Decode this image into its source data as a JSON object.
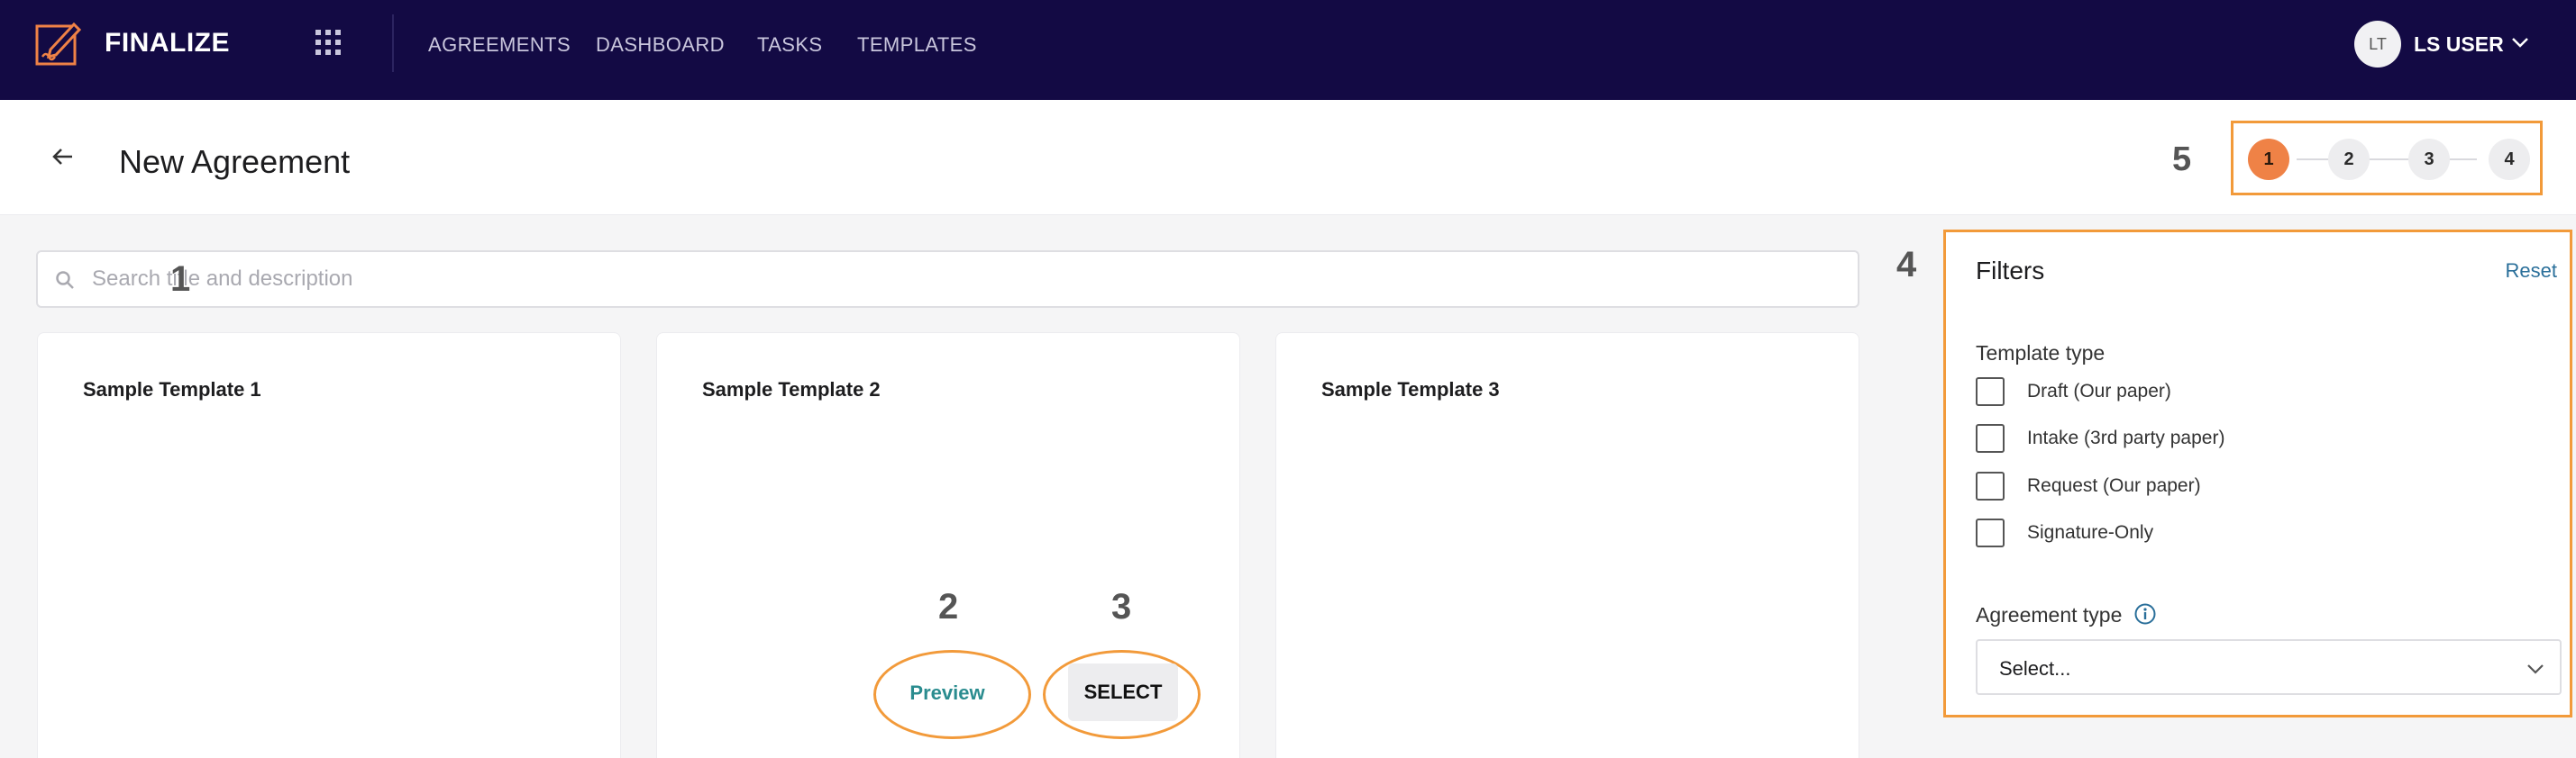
{
  "app": {
    "brand": "FINALIZE"
  },
  "nav": {
    "items": [
      "AGREEMENTS",
      "DASHBOARD",
      "TASKS",
      "TEMPLATES"
    ]
  },
  "user": {
    "initials": "LT",
    "name": "LS USER"
  },
  "page": {
    "title": "New Agreement"
  },
  "stepper": {
    "steps": [
      "1",
      "2",
      "3",
      "4"
    ],
    "current_step": 1
  },
  "search": {
    "placeholder": "Search title and description",
    "value": ""
  },
  "templates": [
    "Sample Template 1",
    "Sample Template 2",
    "Sample Template 3"
  ],
  "card_actions": {
    "preview_label": "Preview",
    "select_label": "SELECT"
  },
  "annotations": {
    "search": "1",
    "preview": "2",
    "select": "3",
    "filters": "4",
    "stepper": "5"
  },
  "filters": {
    "title": "Filters",
    "reset_label": "Reset",
    "template_type_label": "Template type",
    "template_types": [
      "Draft (Our paper)",
      "Intake (3rd party paper)",
      "Request (Our paper)",
      "Signature-Only"
    ],
    "agreement_type_label": "Agreement type",
    "agreement_type_value": "Select..."
  },
  "colors": {
    "nav_bg": "#130a44",
    "accent_orange": "#ef8246",
    "annotation_outline": "#f29a3a",
    "link_teal": "#2a8c8f"
  },
  "icons": [
    "finalize-logo-icon",
    "apps-grid-icon",
    "chevron-down-icon",
    "back-arrow-icon",
    "search-icon",
    "info-icon"
  ]
}
